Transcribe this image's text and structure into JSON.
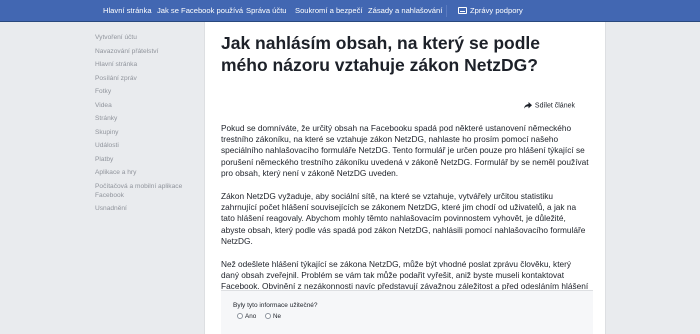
{
  "topnav": {
    "items": [
      "Hlavní stránka",
      "Jak se Facebook používá",
      "Správa účtu",
      "Soukromí a bezpečí",
      "Zásady a nahlašování"
    ],
    "support": "Zprávy podpory"
  },
  "sidebar": {
    "links": [
      "Vytvoření účtu",
      "Navazování přátelství",
      "Hlavní stránka",
      "Posílání zpráv",
      "Fotky",
      "Videa",
      "Stránky",
      "Skupiny",
      "Události",
      "Platby",
      "Aplikace a hry"
    ],
    "mobile_link": [
      "Počítačová a mobilní aplikace",
      "Facebook"
    ],
    "last_link": "Usnadnění"
  },
  "article": {
    "title": "Jak nahlásím obsah, na který se podle mého názoru vztahuje zákon NetzDG?",
    "share": "Sdílet článek",
    "paragraphs": [
      "Pokud se domníváte, že určitý obsah na Facebooku spadá pod některé ustanovení německého trestního zákoníku, na které se vztahuje zákon NetzDG, nahlaste ho prosím pomocí našeho speciálního nahlašovacího formuláře NetzDG. Tento formulář je určen pouze pro hlášení týkající se porušení německého trestního zákoníku uvedená v zákoně NetzDG. Formulář by se neměl používat pro obsah, který není v zákoně NetzDG uveden.",
      "Zákon NetzDG vyžaduje, aby sociální sítě, na které se vztahuje, vytvářely určitou statistiku zahrnující počet hlášení souvisejících se zákonem NetzDG, které jim chodí od uživatelů, a jak na tato hlášení reagovaly. Abychom mohly těmto nahlašovacím povinnostem vyhovět, je důležité, abyste obsah, který podle vás spadá pod zákon NetzDG, nahlásili pomocí nahlašovacího formuláře NetzDG.",
      "Než odešlete hlášení týkající se zákona NetzDG, může být vhodné poslat zprávu člověku, který daný obsah zveřejnil. Problém se vám tak může podařit vyřešit, aniž byste museli kontaktovat Facebook. Obvinění z nezákonnosti navíc představují závažnou záležitost a před odesláním hlášení může být vhodné získat radu od právníka nebo od regulačního úřadu."
    ]
  },
  "feedback": {
    "question": "Byly tyto informace užitečné?",
    "yes": "Ano",
    "no": "Ne"
  },
  "colors": {
    "brand": "#4267b2",
    "background": "#e9ebee",
    "muted_link": "#90949c"
  }
}
